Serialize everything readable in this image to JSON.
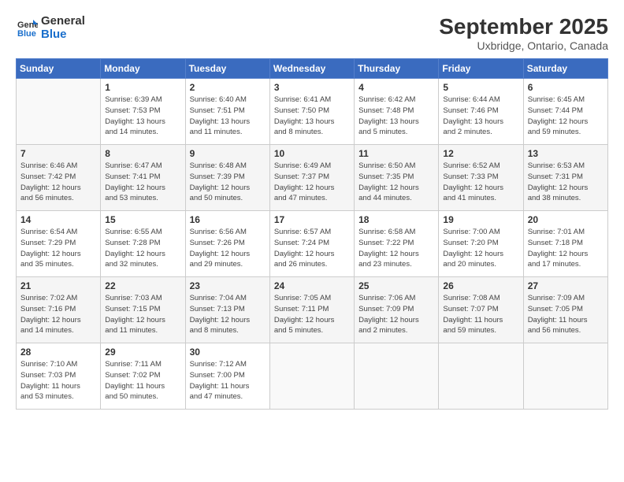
{
  "header": {
    "logo_line1": "General",
    "logo_line2": "Blue",
    "month": "September 2025",
    "location": "Uxbridge, Ontario, Canada"
  },
  "weekdays": [
    "Sunday",
    "Monday",
    "Tuesday",
    "Wednesday",
    "Thursday",
    "Friday",
    "Saturday"
  ],
  "weeks": [
    [
      {
        "day": "",
        "detail": ""
      },
      {
        "day": "1",
        "detail": "Sunrise: 6:39 AM\nSunset: 7:53 PM\nDaylight: 13 hours\nand 14 minutes."
      },
      {
        "day": "2",
        "detail": "Sunrise: 6:40 AM\nSunset: 7:51 PM\nDaylight: 13 hours\nand 11 minutes."
      },
      {
        "day": "3",
        "detail": "Sunrise: 6:41 AM\nSunset: 7:50 PM\nDaylight: 13 hours\nand 8 minutes."
      },
      {
        "day": "4",
        "detail": "Sunrise: 6:42 AM\nSunset: 7:48 PM\nDaylight: 13 hours\nand 5 minutes."
      },
      {
        "day": "5",
        "detail": "Sunrise: 6:44 AM\nSunset: 7:46 PM\nDaylight: 13 hours\nand 2 minutes."
      },
      {
        "day": "6",
        "detail": "Sunrise: 6:45 AM\nSunset: 7:44 PM\nDaylight: 12 hours\nand 59 minutes."
      }
    ],
    [
      {
        "day": "7",
        "detail": "Sunrise: 6:46 AM\nSunset: 7:42 PM\nDaylight: 12 hours\nand 56 minutes."
      },
      {
        "day": "8",
        "detail": "Sunrise: 6:47 AM\nSunset: 7:41 PM\nDaylight: 12 hours\nand 53 minutes."
      },
      {
        "day": "9",
        "detail": "Sunrise: 6:48 AM\nSunset: 7:39 PM\nDaylight: 12 hours\nand 50 minutes."
      },
      {
        "day": "10",
        "detail": "Sunrise: 6:49 AM\nSunset: 7:37 PM\nDaylight: 12 hours\nand 47 minutes."
      },
      {
        "day": "11",
        "detail": "Sunrise: 6:50 AM\nSunset: 7:35 PM\nDaylight: 12 hours\nand 44 minutes."
      },
      {
        "day": "12",
        "detail": "Sunrise: 6:52 AM\nSunset: 7:33 PM\nDaylight: 12 hours\nand 41 minutes."
      },
      {
        "day": "13",
        "detail": "Sunrise: 6:53 AM\nSunset: 7:31 PM\nDaylight: 12 hours\nand 38 minutes."
      }
    ],
    [
      {
        "day": "14",
        "detail": "Sunrise: 6:54 AM\nSunset: 7:29 PM\nDaylight: 12 hours\nand 35 minutes."
      },
      {
        "day": "15",
        "detail": "Sunrise: 6:55 AM\nSunset: 7:28 PM\nDaylight: 12 hours\nand 32 minutes."
      },
      {
        "day": "16",
        "detail": "Sunrise: 6:56 AM\nSunset: 7:26 PM\nDaylight: 12 hours\nand 29 minutes."
      },
      {
        "day": "17",
        "detail": "Sunrise: 6:57 AM\nSunset: 7:24 PM\nDaylight: 12 hours\nand 26 minutes."
      },
      {
        "day": "18",
        "detail": "Sunrise: 6:58 AM\nSunset: 7:22 PM\nDaylight: 12 hours\nand 23 minutes."
      },
      {
        "day": "19",
        "detail": "Sunrise: 7:00 AM\nSunset: 7:20 PM\nDaylight: 12 hours\nand 20 minutes."
      },
      {
        "day": "20",
        "detail": "Sunrise: 7:01 AM\nSunset: 7:18 PM\nDaylight: 12 hours\nand 17 minutes."
      }
    ],
    [
      {
        "day": "21",
        "detail": "Sunrise: 7:02 AM\nSunset: 7:16 PM\nDaylight: 12 hours\nand 14 minutes."
      },
      {
        "day": "22",
        "detail": "Sunrise: 7:03 AM\nSunset: 7:15 PM\nDaylight: 12 hours\nand 11 minutes."
      },
      {
        "day": "23",
        "detail": "Sunrise: 7:04 AM\nSunset: 7:13 PM\nDaylight: 12 hours\nand 8 minutes."
      },
      {
        "day": "24",
        "detail": "Sunrise: 7:05 AM\nSunset: 7:11 PM\nDaylight: 12 hours\nand 5 minutes."
      },
      {
        "day": "25",
        "detail": "Sunrise: 7:06 AM\nSunset: 7:09 PM\nDaylight: 12 hours\nand 2 minutes."
      },
      {
        "day": "26",
        "detail": "Sunrise: 7:08 AM\nSunset: 7:07 PM\nDaylight: 11 hours\nand 59 minutes."
      },
      {
        "day": "27",
        "detail": "Sunrise: 7:09 AM\nSunset: 7:05 PM\nDaylight: 11 hours\nand 56 minutes."
      }
    ],
    [
      {
        "day": "28",
        "detail": "Sunrise: 7:10 AM\nSunset: 7:03 PM\nDaylight: 11 hours\nand 53 minutes."
      },
      {
        "day": "29",
        "detail": "Sunrise: 7:11 AM\nSunset: 7:02 PM\nDaylight: 11 hours\nand 50 minutes."
      },
      {
        "day": "30",
        "detail": "Sunrise: 7:12 AM\nSunset: 7:00 PM\nDaylight: 11 hours\nand 47 minutes."
      },
      {
        "day": "",
        "detail": ""
      },
      {
        "day": "",
        "detail": ""
      },
      {
        "day": "",
        "detail": ""
      },
      {
        "day": "",
        "detail": ""
      }
    ]
  ]
}
